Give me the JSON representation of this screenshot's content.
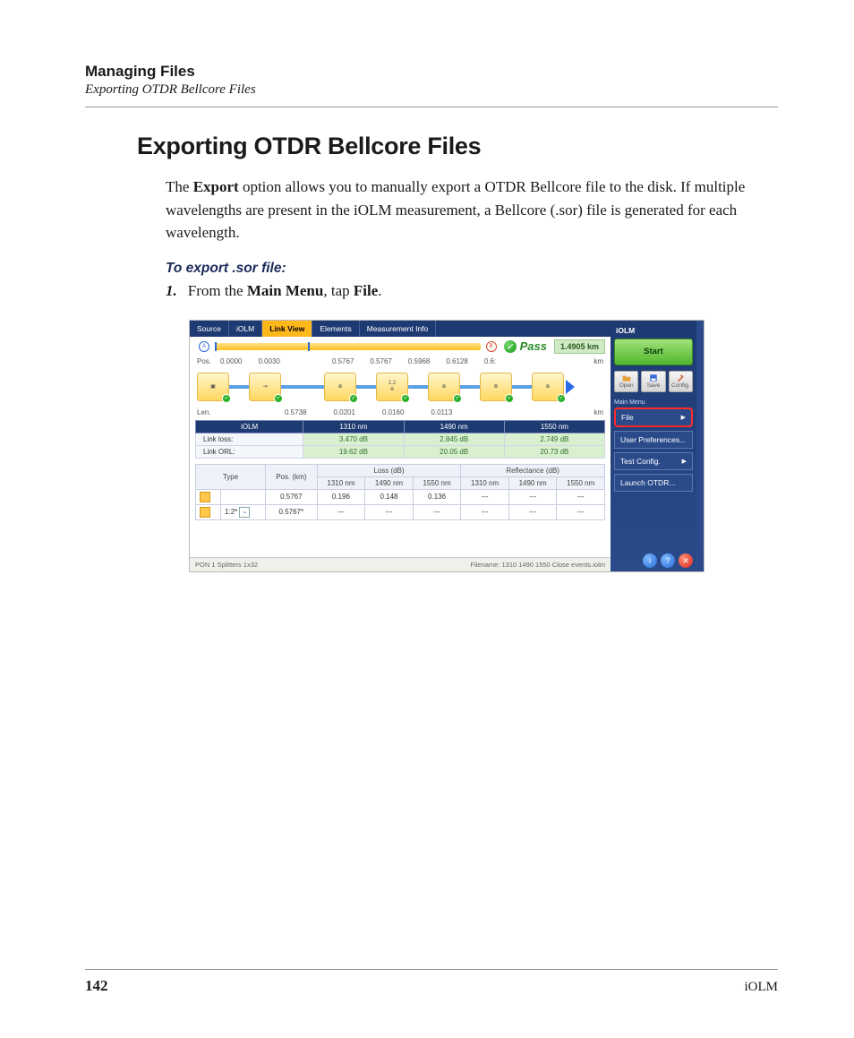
{
  "header": {
    "chapter": "Managing Files",
    "section_running": "Exporting OTDR Bellcore Files"
  },
  "heading": "Exporting OTDR Bellcore Files",
  "intro": {
    "pre": "The ",
    "bold": "Export",
    "post": " option allows you to manually export a OTDR Bellcore file to the disk. If multiple wavelengths are present in the iOLM measurement, a Bellcore (.sor) file is generated for each wavelength."
  },
  "subhead": "To export .sor file:",
  "step1": {
    "num": "1.",
    "pre": "From the ",
    "b1": "Main Menu",
    "mid": ", tap ",
    "b2": "File",
    "end": "."
  },
  "screenshot": {
    "tabs": [
      "Source",
      "iOLM",
      "Link View",
      "Elements",
      "Measurement Info"
    ],
    "active_tab": "Link View",
    "pass_label": "Pass",
    "distance_badge": "1.4905 km",
    "pos_label": "Pos.",
    "pos_values": [
      "0.0000",
      "0.0030",
      "0.5767",
      "0.5767",
      "0.5968",
      "0.6128",
      "0.6:"
    ],
    "km_unit": "km",
    "len_label": "Len.",
    "len_values": [
      "0.5738",
      "0.0201",
      "0.0160",
      "0.0113"
    ],
    "node_splitter_label": "1:2",
    "meas": {
      "header": "iOLM",
      "wavelengths": [
        "1310 nm",
        "1490 nm",
        "1550 nm"
      ],
      "rows": [
        {
          "label": "Link loss:",
          "values": [
            "3.470 dB",
            "2.845 dB",
            "2.749 dB"
          ]
        },
        {
          "label": "Link ORL:",
          "values": [
            "19.62 dB",
            "20.05 dB",
            "20.73 dB"
          ]
        }
      ]
    },
    "events": {
      "cols": {
        "type": "Type",
        "pos": "Pos. (km)",
        "loss": "Loss (dB)",
        "refl": "Reflectance (dB)"
      },
      "wavelengths": [
        "1310 nm",
        "1490 nm",
        "1550 nm"
      ],
      "rows": [
        {
          "type": "",
          "pos": "0.5767",
          "loss": [
            "0.196",
            "0.148",
            "0.136"
          ],
          "refl": [
            "---",
            "---",
            "---"
          ]
        },
        {
          "type": "1:2*",
          "pos": "0.5767*",
          "loss": [
            "---",
            "---",
            "---"
          ],
          "refl": [
            "---",
            "---",
            "---"
          ]
        }
      ]
    },
    "statusbar": {
      "left": "PON 1 Splitters 1x32",
      "right": "Filename: 1310 1490 1550 Close events.iolm"
    },
    "sidebar": {
      "title": "iOLM",
      "start": "Start",
      "toolbar": [
        {
          "label": "Open"
        },
        {
          "label": "Save"
        },
        {
          "label": "Config."
        }
      ],
      "group_label": "Main Menu",
      "items": [
        {
          "label": "File",
          "highlight": true
        },
        {
          "label": "User Preferences..."
        },
        {
          "label": "Test Config."
        },
        {
          "label": "Launch OTDR..."
        }
      ]
    }
  },
  "footer": {
    "page_number": "142",
    "product": "iOLM"
  }
}
